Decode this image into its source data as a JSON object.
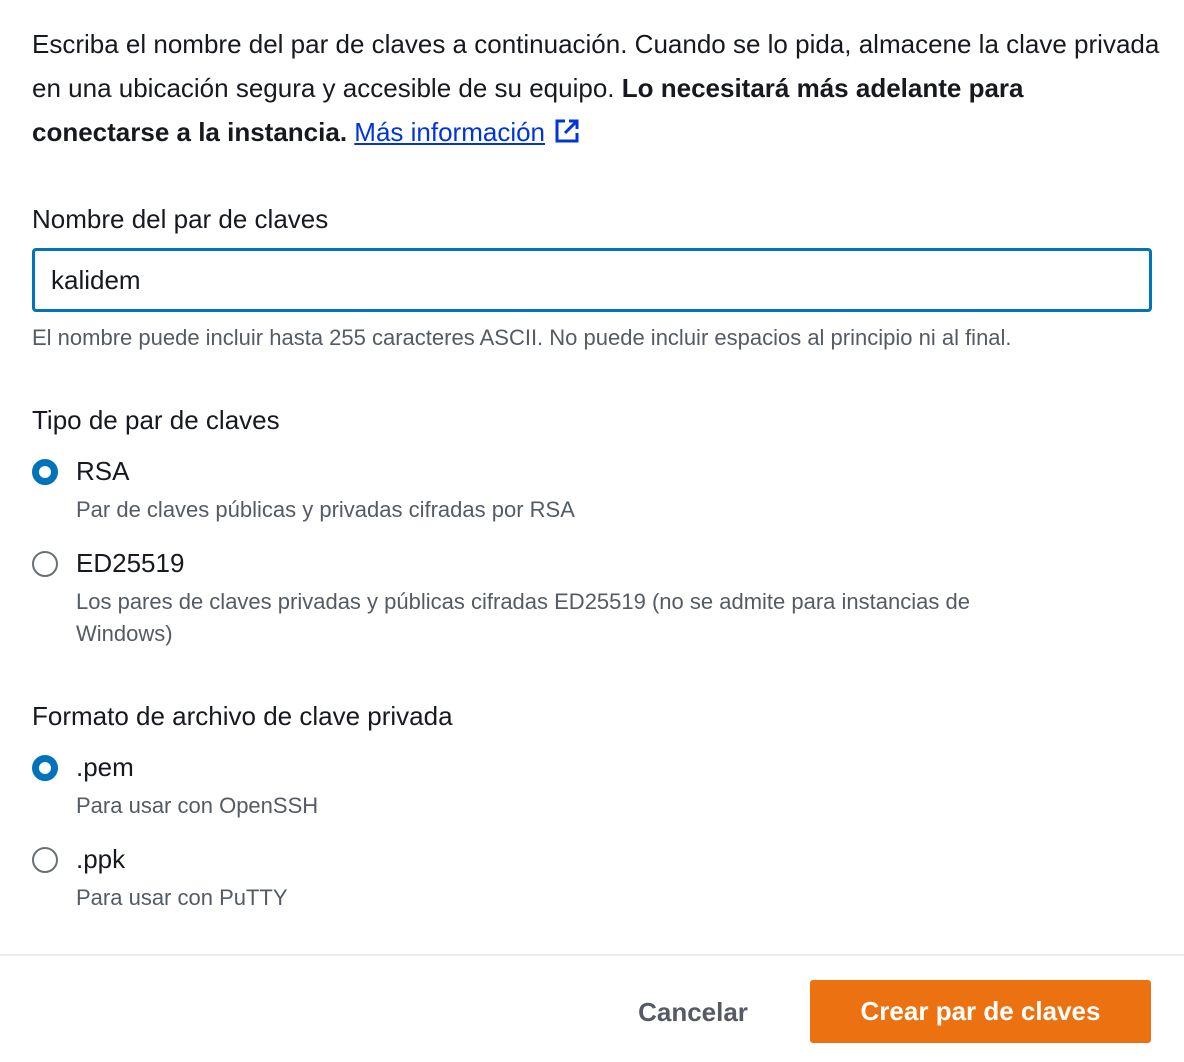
{
  "intro": {
    "text_part1": "Escriba el nombre del par de claves a continuación. Cuando se lo pida, almacene la clave privada en una ubicación segura y accesible de su equipo. ",
    "text_bold": "Lo necesitará más adelante para conectarse a la instancia.",
    "link_label": "Más información",
    "link_icon": "external-link-icon"
  },
  "key_name": {
    "label": "Nombre del par de claves",
    "value": "kalidem",
    "hint": "El nombre puede incluir hasta 255 caracteres ASCII. No puede incluir espacios al principio ni al final."
  },
  "key_type": {
    "label": "Tipo de par de claves",
    "options": [
      {
        "label": "RSA",
        "description": "Par de claves públicas y privadas cifradas por RSA",
        "selected": true
      },
      {
        "label": "ED25519",
        "description": "Los pares de claves privadas y públicas cifradas ED25519 (no se admite para instancias de Windows)",
        "selected": false
      }
    ]
  },
  "file_format": {
    "label": "Formato de archivo de clave privada",
    "options": [
      {
        "label": ".pem",
        "description": "Para usar con OpenSSH",
        "selected": true
      },
      {
        "label": ".ppk",
        "description": "Para usar con PuTTY",
        "selected": false
      }
    ]
  },
  "footer": {
    "cancel_label": "Cancelar",
    "create_label": "Crear par de claves"
  },
  "colors": {
    "accent": "#0073bb",
    "primary_button": "#ec7211",
    "link": "#0034dd",
    "secondary_text": "#545b64"
  }
}
